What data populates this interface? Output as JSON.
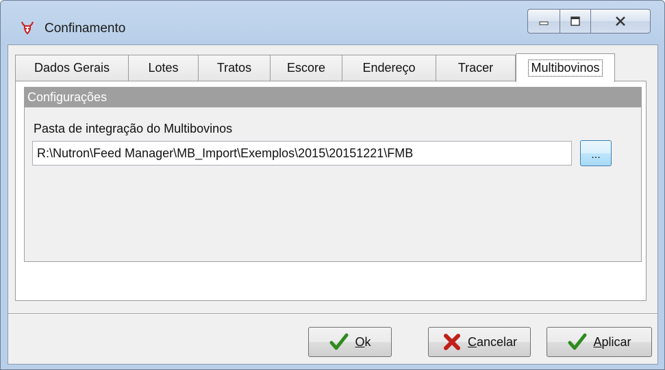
{
  "window": {
    "title": "Confinamento",
    "controls": [
      "minimize-icon",
      "maximize-icon",
      "close-icon"
    ]
  },
  "tabs": [
    {
      "label": "Dados Gerais",
      "active": false
    },
    {
      "label": "Lotes",
      "active": false
    },
    {
      "label": "Tratos",
      "active": false
    },
    {
      "label": "Escore",
      "active": false
    },
    {
      "label": "Endereço",
      "active": false
    },
    {
      "label": "Tracer",
      "active": false
    },
    {
      "label": "Multibovinos",
      "active": true
    }
  ],
  "config": {
    "group_title": "Configurações",
    "path_label": "Pasta de integração do Multibovinos",
    "path_value": "R:\\Nutron\\Feed Manager\\MB_Import\\Exemplos\\2015\\20151221\\FMB",
    "browse_label": "..."
  },
  "buttons": {
    "ok": {
      "accel": "O",
      "rest": "k",
      "icon": "check-icon"
    },
    "cancel": {
      "accel": "C",
      "rest": "ancelar",
      "icon": "x-icon"
    },
    "apply": {
      "accel": "A",
      "rest": "plicar",
      "icon": "check-icon"
    }
  },
  "colors": {
    "check": "#2e8b1e",
    "cross": "#c0201a",
    "group_header": "#9f9f9f"
  }
}
